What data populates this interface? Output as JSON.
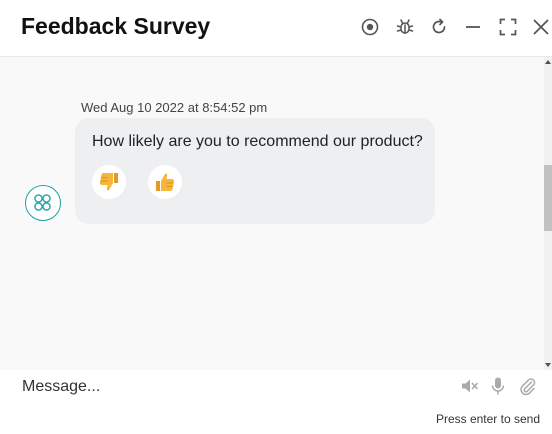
{
  "header": {
    "title": "Feedback Survey",
    "icons": [
      "record-icon",
      "bug-icon",
      "refresh-icon",
      "minimize-icon",
      "expand-icon",
      "close-icon"
    ]
  },
  "chat": {
    "messages": [
      {
        "timestamp": "Wed Aug 10 2022 at 8:54:52 pm",
        "text": "How likely are you to recommend our product?",
        "reactions": [
          "thumbs-down",
          "thumbs-up"
        ]
      }
    ]
  },
  "composer": {
    "placeholder": "Message...",
    "hint": "Press enter to send",
    "icons": [
      "mute-icon",
      "microphone-icon",
      "attachment-icon"
    ]
  },
  "colors": {
    "accent": "#1aa5a5",
    "bubble": "#eeeff1",
    "chat_bg": "#f9f9f9",
    "emoji": "#f4b73a"
  }
}
